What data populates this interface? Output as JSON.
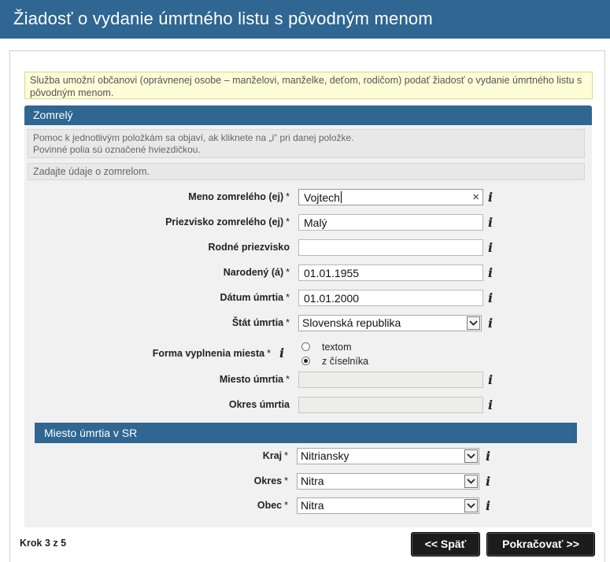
{
  "header": {
    "title": "Žiadosť o vydanie úmrtného listu s pôvodným menom"
  },
  "notice": "Služba umožní občanovi (oprávnenej osobe – manželovi, manželke, deťom, rodičom) podať žiadosť o vydanie úmrtného listu s pôvodným menom.",
  "section": {
    "title": "Zomrelý",
    "help_line1": "Pomoc k jednotlivým položkám sa objaví, ak kliknete na „i“ pri danej položke.",
    "help_line2": "Povinné polia sú označené hviezdičkou.",
    "instruction": "Zadajte údaje o zomrelom."
  },
  "required_mark": "*",
  "info_glyph": "i",
  "fields": {
    "first_name": {
      "label": "Meno zomrelého (ej)",
      "value": "Vojtech",
      "clear": "×"
    },
    "surname": {
      "label": "Priezvisko zomrelého (ej)",
      "value": "Malý"
    },
    "birth_surname": {
      "label": "Rodné priezvisko",
      "value": ""
    },
    "born": {
      "label": "Narodený (á)",
      "value": "01.01.1955"
    },
    "death_date": {
      "label": "Dátum úmrtia",
      "value": "01.01.2000"
    },
    "death_country": {
      "label": "Štát úmrtia",
      "value": "Slovenská republika"
    },
    "place_form": {
      "label": "Forma vyplnenia miesta",
      "options": [
        "textom",
        "z číselníka"
      ],
      "selected": "z číselníka"
    },
    "death_place": {
      "label": "Miesto úmrtia",
      "value": ""
    },
    "death_district": {
      "label": "Okres úmrtia",
      "value": ""
    }
  },
  "sr": {
    "title": "Miesto úmrtia v SR",
    "region": {
      "label": "Kraj",
      "value": "Nitriansky"
    },
    "district": {
      "label": "Okres",
      "value": "Nitra"
    },
    "municipality": {
      "label": "Obec",
      "value": "Nitra"
    }
  },
  "footer": {
    "step": "Krok 3 z 5",
    "back_label": "<< Späť",
    "next_label": "Pokračovať >>"
  },
  "colors": {
    "brand": "#2f6692",
    "notice_bg": "#fdfdd8",
    "panel_bg": "#f1f1f1",
    "button_bg": "#1c1c1c"
  }
}
